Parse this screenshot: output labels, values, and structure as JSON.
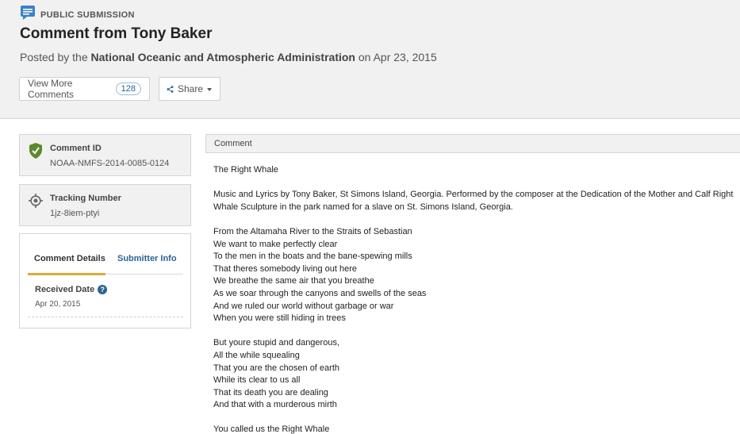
{
  "header": {
    "doc_type": "PUBLIC SUBMISSION",
    "doc_type_icon": "comment-icon",
    "title": "Comment from Tony Baker",
    "posted_prefix": "Posted by the",
    "agency": "National Oceanic and Atmospheric Administration",
    "posted_on": "on",
    "date": "Apr 23, 2015",
    "view_more_label": "View More Comments",
    "view_more_count": "128",
    "share_label": "Share"
  },
  "sidebar": {
    "comment_id_label": "Comment ID",
    "comment_id_value": "NOAA-NMFS-2014-0085-0124",
    "tracking_label": "Tracking Number",
    "tracking_value": "1jz-8iem-ptyi",
    "tabs": [
      "Comment Details",
      "Submitter Info"
    ],
    "received_label": "Received Date",
    "received_value": "Apr 20, 2015"
  },
  "comment": {
    "heading": "Comment",
    "paragraphs": [
      [
        "The Right Whale"
      ],
      [
        "Music and Lyrics by Tony Baker, St Simons Island, Georgia. Performed by the composer at the Dedication of the Mother and Calf Right",
        "Whale Sculpture in the park named for a slave on St. Simons Island, Georgia."
      ],
      [
        "From the Altamaha River to the Straits of Sebastian",
        "We want to make perfectly clear",
        "To the men in the boats and the bane-spewing mills",
        "That theres somebody living out here",
        "We breathe the same air that you breathe",
        "As we soar through the canyons and swells of the seas",
        "And we ruled our world without garbage or war",
        "When you were still hiding in trees"
      ],
      [
        "But youre stupid and dangerous,",
        "All the while squealing",
        "That you are the chosen of earth",
        "While its clear to us all",
        "That its death you are dealing",
        "And that with a murderous mirth"
      ],
      [
        "You called us the Right Whale"
      ]
    ]
  },
  "colors": {
    "header_bg": "#f1f1f1",
    "link_blue": "#2a6496",
    "tab_underline": "#e0a93a",
    "shield_green": "#5a8a2c"
  }
}
